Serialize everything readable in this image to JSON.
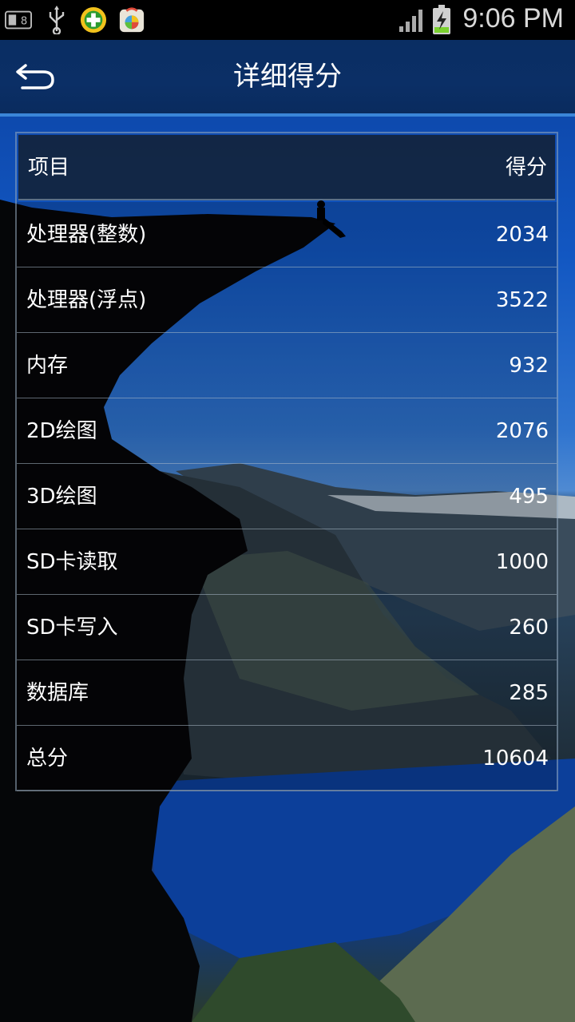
{
  "status_bar": {
    "time": "9:06 PM",
    "icons": [
      "sim-card-icon",
      "usb-icon",
      "app-plus-icon",
      "app-store-icon",
      "signal-icon",
      "battery-charging-icon"
    ]
  },
  "header": {
    "title": "详细得分",
    "back_icon": "back-arrow-icon"
  },
  "table": {
    "header": {
      "item": "项目",
      "score": "得分"
    },
    "rows": [
      {
        "item": "处理器(整数)",
        "score": "2034"
      },
      {
        "item": "处理器(浮点)",
        "score": "3522"
      },
      {
        "item": "内存",
        "score": "932"
      },
      {
        "item": "2D绘图",
        "score": "2076"
      },
      {
        "item": "3D绘图",
        "score": "495"
      },
      {
        "item": "SD卡读取",
        "score": "1000"
      },
      {
        "item": "SD卡写入",
        "score": "260"
      },
      {
        "item": "数据库",
        "score": "285"
      },
      {
        "item": "总分",
        "score": "10604"
      }
    ]
  },
  "colors": {
    "title_bar": "#0b2f66",
    "accent_line": "#3b86d8",
    "text": "#ffffff"
  }
}
